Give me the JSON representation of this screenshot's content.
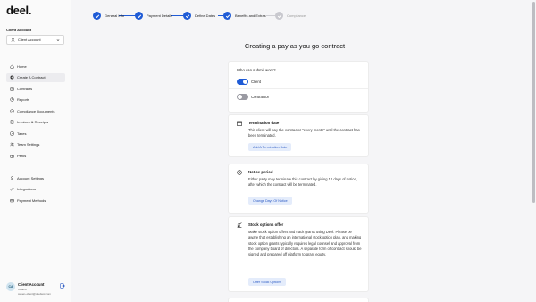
{
  "sidebar": {
    "logo": "deel",
    "logo_dot": ".",
    "account_label": "Client Account",
    "account_select": "Client Account",
    "nav": [
      {
        "label": "Home",
        "icon": "home-icon"
      },
      {
        "label": "Create A Contract",
        "icon": "plus-circle-icon"
      },
      {
        "label": "Contracts",
        "icon": "document-icon"
      },
      {
        "label": "Reports",
        "icon": "reports-icon"
      },
      {
        "label": "Compliance Documents",
        "icon": "shield-check-icon"
      },
      {
        "label": "Invoices & Receipts",
        "icon": "invoice-icon"
      },
      {
        "label": "Taxes",
        "icon": "tax-icon"
      },
      {
        "label": "Team Settings",
        "icon": "team-icon"
      },
      {
        "label": "Perks",
        "icon": "gift-icon"
      }
    ],
    "nav2": [
      {
        "label": "Account Settings",
        "icon": "user-icon"
      },
      {
        "label": "Integrations",
        "icon": "link-icon"
      },
      {
        "label": "Payment Methods",
        "icon": "payment-icon"
      }
    ],
    "profile": {
      "initials": "CA",
      "name": "Client Account",
      "role": "CLIENT",
      "email": "ceuen+client@deeltest.com"
    }
  },
  "stepper": [
    {
      "label": "General Info",
      "done": true
    },
    {
      "label": "Payment Details",
      "done": true
    },
    {
      "label": "Define Dates",
      "done": true
    },
    {
      "label": "Benefits and Extras",
      "done": true
    },
    {
      "label": "Compliance",
      "done": false
    }
  ],
  "main": {
    "title": "Creating a pay as you go contract",
    "submit": {
      "question": "Who can submit work?",
      "client": "Client",
      "contractor": "Contractor"
    },
    "termination": {
      "title": "Termination date",
      "body": "This client will pay the contractor \"every month\" until the contract has been terminated.",
      "button": "Add A Termination Date"
    },
    "notice": {
      "title": "Notice period",
      "body": "Either party may terminate this contract by giving 10 days of notice, after which the contract will be terminated.",
      "button": "Change Days Of Notice"
    },
    "stock": {
      "title": "Stock options offer",
      "body": "Make stock option offers and track grants using Deel. Please be aware that establishing an international stock option plan, and making stock option grants typically requires legal counsel and approval from the company board of directors. A separate form of contract should be signed and prepared off platform to grant equity.",
      "button": "Offer Stock Options"
    }
  },
  "colors": {
    "accent": "#1f5bd6",
    "button_bg": "#e4ecfb",
    "button_text": "#2c5bc4"
  }
}
